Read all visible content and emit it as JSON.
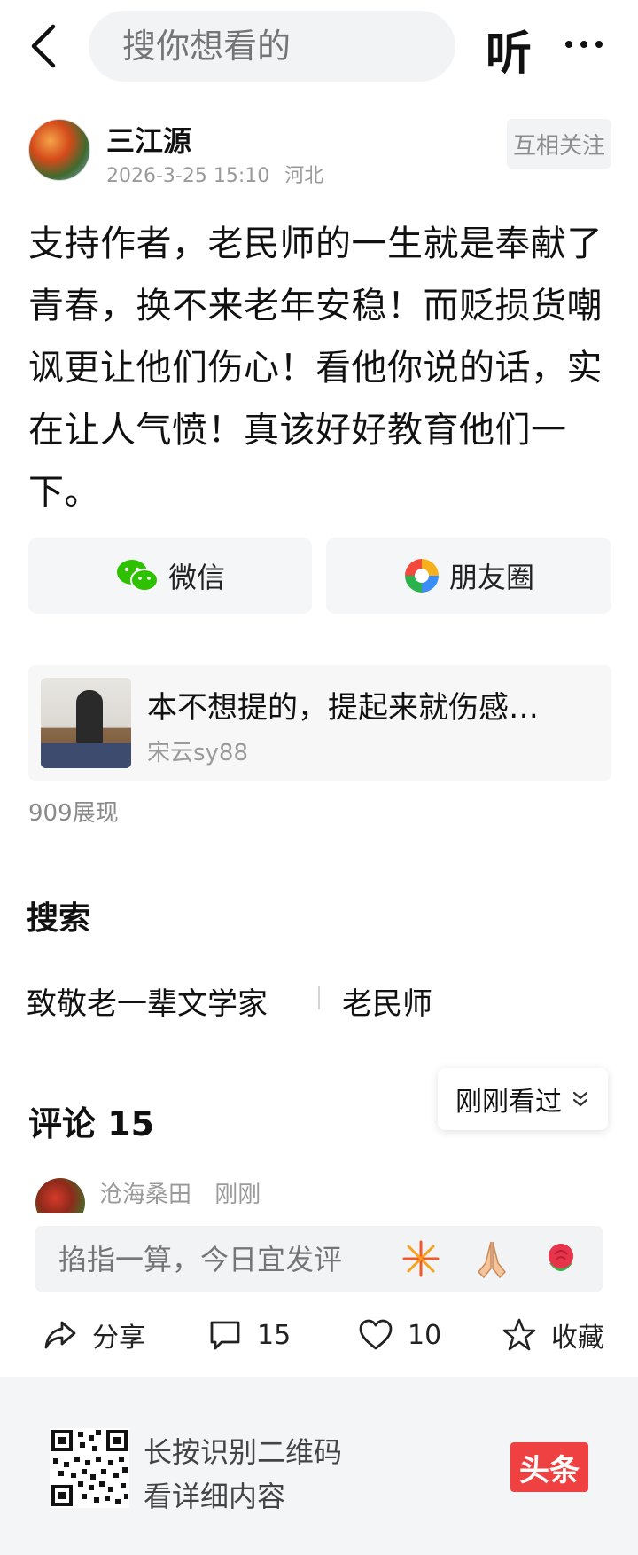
{
  "search": {
    "placeholder": "搜你想看的",
    "listen_label": "听"
  },
  "author": {
    "name": "三江源",
    "time": "2026-3-25 15:10",
    "location": "河北",
    "follow_label": "互相关注"
  },
  "post": {
    "text": "支持作者，老民师的一生就是奉献了青春，换不来老年安稳！而贬损货嘲讽更让他们伤心！看他你说的话，实在让人气愤！真该好好教育他们一下。"
  },
  "share": {
    "wechat_label": "微信",
    "moments_label": "朋友圈"
  },
  "related": {
    "title": "本不想提的，提起来就伤感…",
    "author": "宋云sy88"
  },
  "views_label": "909展现",
  "search_section": {
    "title": "搜索",
    "tags": [
      "致敬老一辈文学家",
      "老民师"
    ]
  },
  "comments": {
    "title": "评论 15",
    "sort_label": "刚刚看过",
    "first_user": "沧海桑田",
    "first_time": "刚刚",
    "input_placeholder": "掐指一算，今日宜发评"
  },
  "actions": {
    "share_label": "分享",
    "comment_count": "15",
    "like_count": "10",
    "favorite_label": "收藏"
  },
  "footer": {
    "line1": "长按识别二维码",
    "line2": "看详细内容",
    "logo_text": "头条"
  },
  "colors": {
    "brand_red": "#f04142",
    "wechat_green": "#2dc100"
  }
}
